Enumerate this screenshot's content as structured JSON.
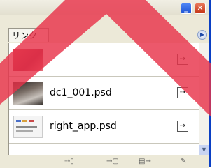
{
  "window": {
    "minimize_glyph": "_",
    "close_glyph": "✕"
  },
  "tabs": [
    {
      "label": "リンク"
    }
  ],
  "panel_menu_glyph": "▶",
  "links": [
    {
      "thumbnail": "red-flowers-image",
      "filename": "",
      "status_glyph": "⇢"
    },
    {
      "thumbnail": "photo-image",
      "filename": "dc1_001.psd",
      "status_glyph": "⇢"
    },
    {
      "thumbnail": "app-screenshot-image",
      "filename": "right_app.psd",
      "status_glyph": "⇢"
    }
  ],
  "scrollbar": {
    "down_glyph": "▼"
  },
  "toolbar": {
    "relink_glyph": "⇢▯",
    "goto_link_glyph": "→▢",
    "update_link_glyph": "▤→",
    "edit_original_glyph": "✎"
  },
  "overlay": {
    "shape": "chevron-up",
    "color": "#e8334a"
  }
}
